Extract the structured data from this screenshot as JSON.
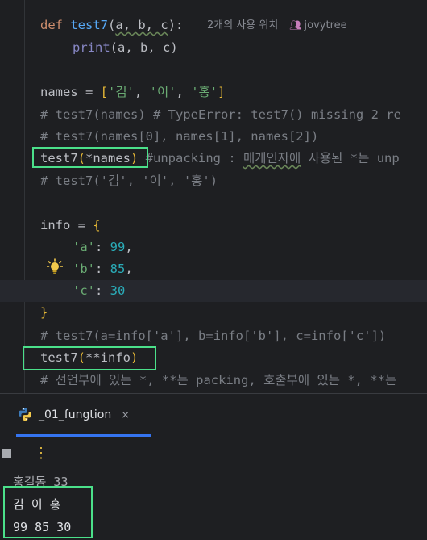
{
  "editor": {
    "code_line_1": {
      "kw": "def",
      "name": "test7",
      "open": "(",
      "params": "a, b, c",
      "close": "):"
    },
    "usage_hint": "2개의 사용 위치",
    "author": "jovytree",
    "code_line_2": {
      "fn": "print",
      "args": "a, b, c"
    },
    "names_line": {
      "var": "names = ",
      "open": "[",
      "s1": "'김'",
      "s2": "'이'",
      "s3": "'홍'",
      "close": "]"
    },
    "comment_1": "# test7(names) # TypeError: test7() missing 2 re",
    "comment_2": "# test7(names[0], names[1], names[2])",
    "call_1": {
      "fn": "test7",
      "open": "(",
      "args": "*names",
      "close": ")"
    },
    "comment_unpack_a": " #unpacking : ",
    "comment_unpack_b": "매개인자에",
    "comment_unpack_c": " 사용된 *는 unp",
    "comment_3": "# test7('김', '이', '홍')",
    "info_line": {
      "var": "info = ",
      "open": "{"
    },
    "dict_a": {
      "key": "'a'",
      "value": "99"
    },
    "dict_b": {
      "key": "'b'",
      "value": "85"
    },
    "dict_c": {
      "key": "'c'",
      "value": "30"
    },
    "dict_close": "}",
    "comment_4": "# test7(a=info['a'], b=info['b'], c=info['c'])",
    "call_2": {
      "fn": "test7",
      "open": "(",
      "args": "**info",
      "close": ")"
    },
    "comment_5": "# 선언부에 있는 *, **는 packing, 호출부에 있는 *, **는"
  },
  "run_panel": {
    "tab_label": "_01_fungtion",
    "close_glyph": "×",
    "more_glyph": "⋮"
  },
  "output": {
    "line_1": "홍길동 33",
    "line_2": "김 이 홍",
    "line_3": "99 85 30"
  },
  "colors": {
    "highlight_box": "#4be08a",
    "keyword": "#cf8e6d",
    "function": "#56a8f5",
    "string": "#6aab73",
    "number": "#2aacb8",
    "comment": "#7a7e85"
  }
}
